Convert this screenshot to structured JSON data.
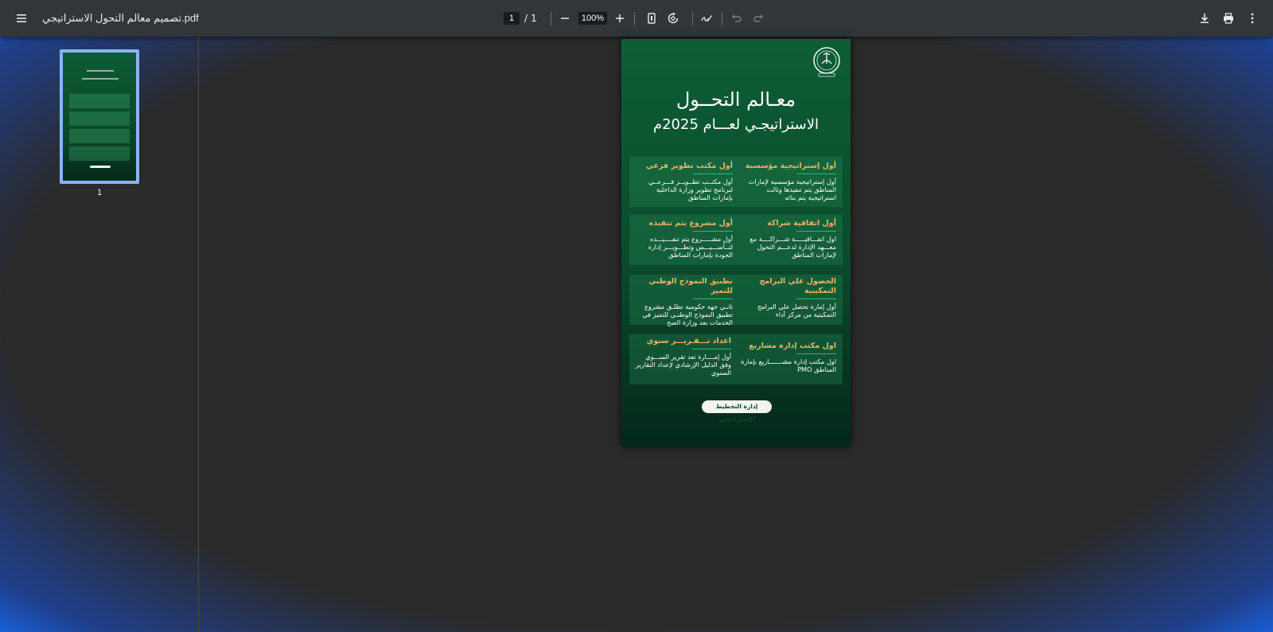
{
  "toolbar": {
    "menu_icon": "hamburger-menu-icon",
    "file_title": "تصميم معالم التحول الاستراتيجي.pdf",
    "current_page": "1",
    "page_separator": "/",
    "total_pages": "1",
    "zoom_level": "100%"
  },
  "sidebar": {
    "thumbnail_label": "1"
  },
  "document": {
    "title_line1": "معـالم التحــول",
    "title_line2": "الاستراتيجـي لعـــام 2025م",
    "blocks": [
      {
        "right": {
          "heading": "أول إستراتيجية مؤسسية",
          "body": "أول إستراتيجية مؤسسية لإمارات المناطق يتم تنفيذها وثالث استراتيجية يتم بنائه"
        },
        "left": {
          "heading": "أول مكتب تطوير فرعي",
          "body": "أول مكتــب تطــويــر فـــرعــي لبرنامج تطوير وزارة الداخلية بإمارات المناطق"
        }
      },
      {
        "right": {
          "heading": "أول اتفاقية شراكة",
          "body": "اول اتفـــاقيـــــة شـــراكــــة مع معـــهد الإدارة لدعـــم التحول لإمارات المناطق"
        },
        "left": {
          "heading": "أول مشروع يتم تنفيذه",
          "body": "أول مشـــــروع يتم تنفــــيـــذه لتــأســـيـــس وتطـــويـــر إدارة الجودة بإمارات المناطق"
        }
      },
      {
        "right": {
          "heading": "الحصول علي البرامج التمكينية",
          "body": "أول إمارة تحصل علي البرامج التمكينية من مركز أداء"
        },
        "left": {
          "heading": "تطبيق النموذج الوطني للتميز",
          "body": "ثانـي جهة حكومية تطلـق مشروع تطبيق النموذج الوطنـي للتميز في الخدمات بعد وزارة الصح"
        }
      },
      {
        "right": {
          "heading": "اول مكتب إدارة مشاريع",
          "body": "اول مكتب إدارة مشـــــــاريع بإمارة المناطق PMO"
        },
        "left": {
          "heading": "اعداد تـــقـريـــر سنوي",
          "body": "أول إمــــارة تعد تقرير الســـوي وفق الدليل الإرشادي لإعداد التقارير السنوي"
        }
      }
    ],
    "footer_badge": "إدارة التخطيط الإستراتيجي"
  }
}
